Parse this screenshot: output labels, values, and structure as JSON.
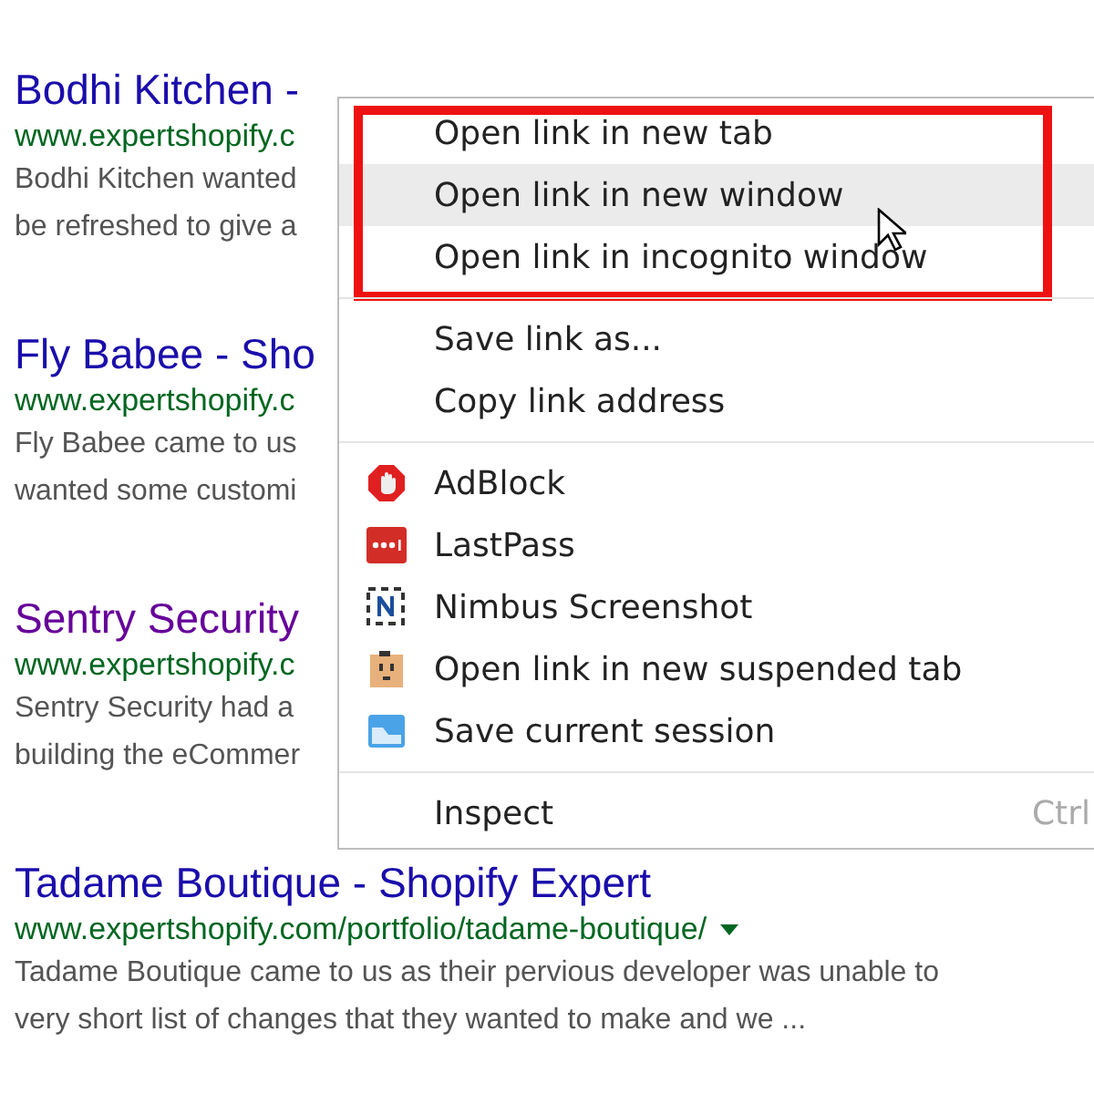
{
  "results": [
    {
      "title": "Bodhi Kitchen -",
      "visited": false,
      "url": "www.expertshopify.c",
      "snippet": [
        "Bodhi Kitchen wanted",
        "be refreshed to give a"
      ]
    },
    {
      "title": "Fly Babee - Sho",
      "visited": false,
      "url": "www.expertshopify.c",
      "snippet": [
        "Fly Babee came to us",
        "wanted some customi"
      ]
    },
    {
      "title": "Sentry Security",
      "visited": true,
      "url": "www.expertshopify.c",
      "snippet": [
        "Sentry Security had a",
        "building the eCommer"
      ]
    },
    {
      "title": "Tadame Boutique - Shopify Expert",
      "visited": false,
      "url": "www.expertshopify.com/portfolio/tadame-boutique/",
      "snippet": [
        "Tadame Boutique came to us as their pervious developer was unable to",
        "very short list of changes that they wanted to make and we ..."
      ]
    }
  ],
  "context_menu": {
    "sections": [
      {
        "annotated": true,
        "items": [
          {
            "label": "Open link in new tab",
            "selected": false
          },
          {
            "label": "Open link in new window",
            "selected": true
          },
          {
            "label": "Open link in incognito window",
            "selected": false
          }
        ]
      },
      {
        "annotated": false,
        "items": [
          {
            "label": "Save link as...",
            "selected": false
          },
          {
            "label": "Copy link address",
            "selected": false
          }
        ]
      },
      {
        "annotated": false,
        "items": [
          {
            "label": "AdBlock",
            "selected": false
          },
          {
            "label": "LastPass",
            "selected": false
          },
          {
            "label": "Nimbus Screenshot",
            "selected": false
          },
          {
            "label": "Open link in new suspended tab",
            "selected": false
          },
          {
            "label": "Save current session",
            "selected": false
          }
        ]
      },
      {
        "annotated": false,
        "items": [
          {
            "label": "Inspect",
            "selected": false,
            "shortcut": "Ctrl"
          }
        ]
      }
    ]
  }
}
